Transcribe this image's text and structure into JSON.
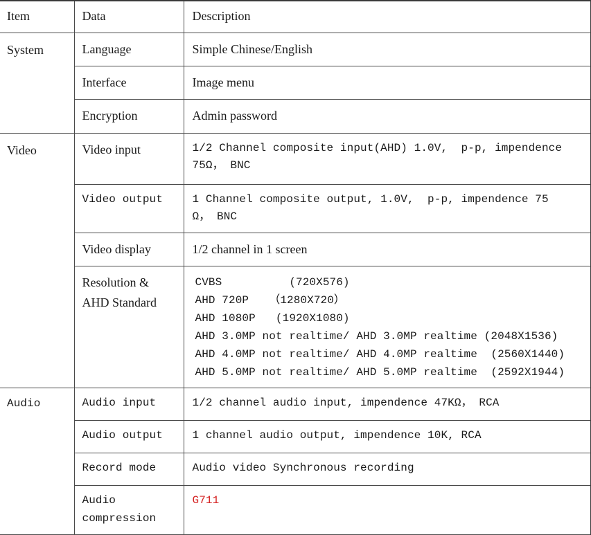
{
  "table": {
    "columns": [
      "Item",
      "Data",
      "Description"
    ],
    "groups": [
      {
        "name": "System",
        "label_style": "serif",
        "rows": [
          {
            "data": "Language",
            "data_style": "serif",
            "desc": "Simple Chinese/English",
            "desc_style": "serif"
          },
          {
            "data": "Interface",
            "data_style": "serif",
            "desc": "Image menu",
            "desc_style": "serif"
          },
          {
            "data": "Encryption",
            "data_style": "serif",
            "desc": "Admin password",
            "desc_style": "serif"
          }
        ]
      },
      {
        "name": "Video",
        "label_style": "serif",
        "rows": [
          {
            "data": "Video input",
            "data_style": "serif",
            "desc_lines": [
              "1/2 Channel composite input(AHD) 1.0V,  p-p, impendence",
              "75Ω， BNC"
            ],
            "desc_style": "mono"
          },
          {
            "data": "Video output",
            "data_style": "mono",
            "desc_lines": [
              "1 Channel composite output, 1.0V,  p-p, impendence 75",
              "Ω， BNC"
            ],
            "desc_style": "mono"
          },
          {
            "data": "Video display",
            "data_style": "serif",
            "desc": "1/2 channel in 1 screen",
            "desc_style": "serif"
          },
          {
            "data": "Resolution & AHD Standard",
            "data_style": "serif",
            "desc_lines": [
              "CVBS          (720X576)",
              "AHD 720P   （1280X720）",
              "AHD 1080P   (1920X1080)",
              "AHD 3.0MP not realtime/ AHD 3.0MP realtime (2048X1536)",
              "AHD 4.0MP not realtime/ AHD 4.0MP realtime  (2560X1440)",
              "AHD 5.0MP not realtime/ AHD 5.0MP realtime  (2592X1944)"
            ],
            "desc_style": "mono"
          }
        ]
      },
      {
        "name": "Audio",
        "label_style": "mono",
        "rows": [
          {
            "data": "Audio input",
            "data_style": "mono",
            "desc": "1/2 channel audio input, impendence 47KΩ， RCA",
            "desc_style": "mono"
          },
          {
            "data": "Audio output",
            "data_style": "mono",
            "desc": "1 channel audio output, impendence 10K, RCA",
            "desc_style": "mono"
          },
          {
            "data": "Record mode",
            "data_style": "mono",
            "desc": "Audio video Synchronous recording",
            "desc_style": "mono"
          },
          {
            "data": "Audio compression",
            "data_style": "mono",
            "desc": "G711",
            "desc_style": "mono",
            "desc_color": "red"
          }
        ]
      }
    ]
  },
  "colors": {
    "highlight_red": "#d42020",
    "border": "#4a4a4a",
    "text": "#1a1a1a",
    "background": "#ffffff"
  },
  "header": {
    "item": "Item",
    "data": "Data",
    "description": "Description"
  },
  "groups": {
    "system": "System",
    "video": "Video",
    "audio": "Audio"
  },
  "system": {
    "language": {
      "label": "Language",
      "value": "Simple Chinese/English"
    },
    "interface": {
      "label": "Interface",
      "value": "Image menu"
    },
    "encryption": {
      "label": "Encryption",
      "value": "Admin password"
    }
  },
  "video": {
    "input": {
      "label": "Video input",
      "line1": "1/2 Channel composite input(AHD) 1.0V,  p-p, impendence",
      "line2": "75Ω， BNC"
    },
    "output": {
      "label": "Video output",
      "line1": "1 Channel composite output, 1.0V,  p-p, impendence 75",
      "line2": "Ω， BNC"
    },
    "display": {
      "label": "Video display",
      "value": "1/2 channel in 1 screen"
    },
    "resolution": {
      "label_line1": "Resolution &",
      "label_line2": "AHD Standard",
      "line1": "CVBS          (720X576)",
      "line2": "AHD 720P   （1280X720）",
      "line3": "AHD 1080P   (1920X1080)",
      "line4": "AHD 3.0MP not realtime/ AHD 3.0MP realtime (2048X1536)",
      "line5": "AHD 4.0MP not realtime/ AHD 4.0MP realtime  (2560X1440)",
      "line6": "AHD 5.0MP not realtime/ AHD 5.0MP realtime  (2592X1944)"
    }
  },
  "audio": {
    "input": {
      "label": "Audio input",
      "value": "1/2 channel audio input, impendence 47KΩ， RCA"
    },
    "output": {
      "label": "Audio output",
      "value": "1 channel audio output, impendence 10K, RCA"
    },
    "record_mode": {
      "label": "Record mode",
      "value": "Audio video Synchronous recording"
    },
    "compression": {
      "label_line1": "Audio",
      "label_line2": "compression",
      "value": "G711"
    }
  }
}
